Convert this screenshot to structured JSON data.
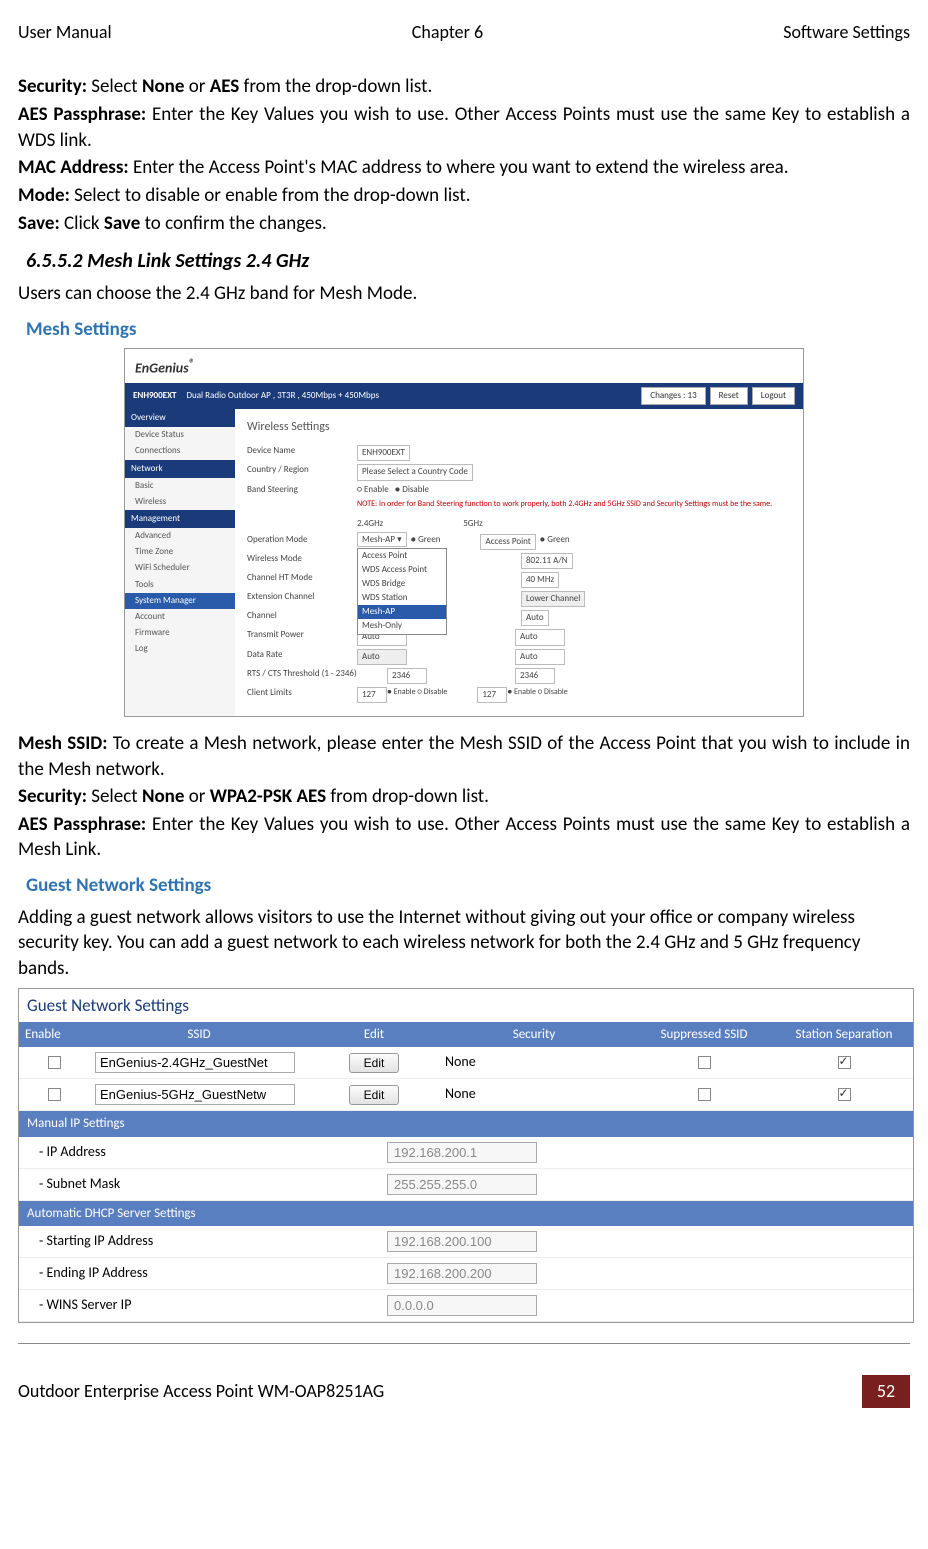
{
  "header": {
    "left": "User Manual",
    "center": "Chapter 6",
    "right": "Software Settings"
  },
  "para1": {
    "l1_bold": "Security:",
    "l1_text": " Select ",
    "l1_b2": "None",
    "l1_t2": " or ",
    "l1_b3": "AES",
    "l1_t3": " from the drop-down list.",
    "l2_bold": "AES Passphrase:",
    "l2_text": " Enter the Key Values you wish to use. Other Access Points must use the same Key to establish a WDS link.",
    "l3_bold": "MAC Address:",
    "l3_text": " Enter the Access Point's MAC address to where you want to extend the wireless area.",
    "l4_bold": "Mode:",
    "l4_text": " Select to disable or enable from the drop-down list.",
    "l5_bold": "Save:",
    "l5_t1": " Click ",
    "l5_b2": "Save",
    "l5_t2": " to confirm the changes."
  },
  "section_num": "6.5.5.2 Mesh Link Settings 2.4 GHz",
  "section_text": "Users can choose the 2.4 GHz band for Mesh Mode.",
  "mesh_heading": "Mesh Settings",
  "ss1": {
    "brand": "EnGenius",
    "model": "ENH900EXT",
    "desc": "Dual Radio Outdoor AP , 3T3R , 450Mbps + 450Mbps",
    "changes": "Changes : 13",
    "reset": "Reset",
    "logout": "Logout",
    "side": {
      "overview": "Overview",
      "device_status": "Device Status",
      "connections": "Connections",
      "network": "Network",
      "basic": "Basic",
      "wireless": "Wireless",
      "management": "Management",
      "advanced": "Advanced",
      "time_zone": "Time Zone",
      "wifi_sched": "WiFi Scheduler",
      "tools": "Tools",
      "system_mgr": "System Manager",
      "account": "Account",
      "firmware": "Firmware",
      "log": "Log"
    },
    "main": {
      "title": "Wireless Settings",
      "device_name_l": "Device Name",
      "device_name_v": "ENH900EXT",
      "country_l": "Country / Region",
      "country_v": "Please Select a Country Code",
      "band_l": "Band Steering",
      "band_enable": "Enable",
      "band_disable": "Disable",
      "note": "NOTE: In order for Band Steering function to work properly, both 2.4GHz and 5GHz SSID and Security Settings must be the same.",
      "col24": "2.4GHz",
      "col5": "5GHz",
      "op_mode_l": "Operation Mode",
      "wireless_mode_l": "Wireless Mode",
      "channel_ht_l": "Channel HT Mode",
      "ext_chan_l": "Extension Channel",
      "channel_l": "Channel",
      "tx_power_l": "Transmit Power",
      "data_rate_l": "Data Rate",
      "rts_l": "RTS / CTS Threshold (1 - 2346)",
      "client_l": "Client Limits",
      "dd_sel": "Mesh-AP",
      "green": "Green",
      "dd": {
        "ap": "Access Point",
        "wds_ap": "WDS Access Point",
        "wds_bridge": "WDS Bridge",
        "wds_station": "WDS Station",
        "mesh_ap": "Mesh-AP",
        "mesh_only": "Mesh-Only"
      },
      "col5_ap": "Access Point",
      "col5_mode": "802.11 A/N",
      "col5_ht": "40 MHz",
      "col5_ext": "Lower Channel",
      "col5_chan": "Auto",
      "col5_tx": "Auto",
      "col5_dr": "Auto",
      "rts_v": "2346",
      "client_v": "127",
      "enable": "Enable",
      "disable": "Disable"
    }
  },
  "para2": {
    "l1_bold": "Mesh SSID:",
    "l1_text": " To create a Mesh network, please enter the Mesh SSID of the Access Point that you wish to include in the Mesh network.",
    "l2_bold": "Security:",
    "l2_t1": " Select ",
    "l2_b2": "None",
    "l2_t2": " or ",
    "l2_b3": "WPA2-PSK AES",
    "l2_t3": " from drop-down list.",
    "l3_bold": "AES Passphrase:",
    "l3_text": " Enter the Key Values you wish to use. Other Access Points must use the same Key to establish a Mesh Link."
  },
  "guest_heading": "Guest Network Settings",
  "guest_text": "Adding a guest network allows visitors to use the Internet without giving out your office or company wireless security key. You can add a guest network to each wireless network for both the 2.4 GHz and 5 GHz frequency bands.",
  "ss2": {
    "title": "Guest Network Settings",
    "th": {
      "enable": "Enable",
      "ssid": "SSID",
      "edit": "Edit",
      "security": "Security",
      "suppressed": "Suppressed SSID",
      "separation": "Station Separation"
    },
    "rows": [
      {
        "ssid": "EnGenius-2.4GHz_GuestNet",
        "edit": "Edit",
        "security": "None"
      },
      {
        "ssid": "EnGenius-5GHz_GuestNetw",
        "edit": "Edit",
        "security": "None"
      }
    ],
    "manual_ip": "Manual IP Settings",
    "ip_addr_l": "- IP Address",
    "ip_addr_v": "192.168.200.1",
    "subnet_l": "- Subnet Mask",
    "subnet_v": "255.255.255.0",
    "dhcp": "Automatic DHCP Server Settings",
    "start_l": "- Starting IP Address",
    "start_v": "192.168.200.100",
    "end_l": "- Ending IP Address",
    "end_v": "192.168.200.200",
    "wins_l": "- WINS Server IP",
    "wins_v": "0.0.0.0"
  },
  "footer": {
    "left": "Outdoor Enterprise Access Point WM-OAP8251AG",
    "page": "52"
  }
}
